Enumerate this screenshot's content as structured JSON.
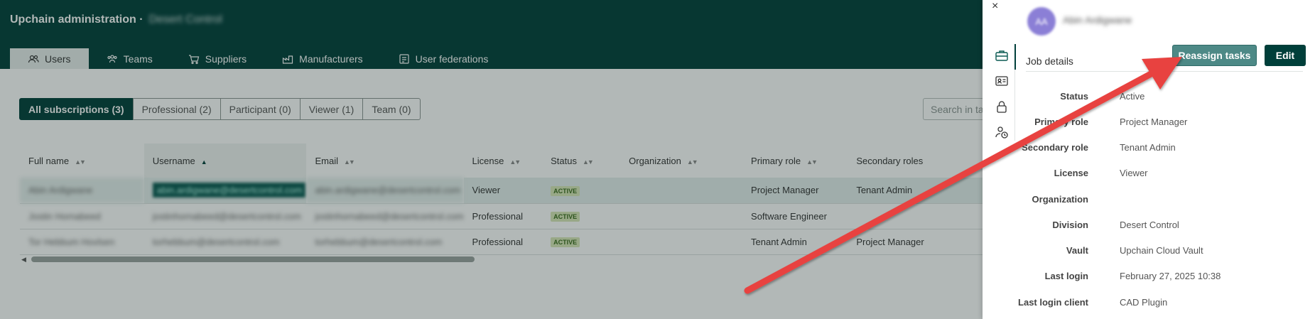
{
  "header": {
    "title": "Upchain administration ·",
    "org_name": "Desert Control"
  },
  "tabs": [
    {
      "label": "Users",
      "icon": "users-icon"
    },
    {
      "label": "Teams",
      "icon": "teams-icon"
    },
    {
      "label": "Suppliers",
      "icon": "suppliers-icon"
    },
    {
      "label": "Manufacturers",
      "icon": "manufacturers-icon"
    },
    {
      "label": "User federations",
      "icon": "federation-icon"
    }
  ],
  "filters": [
    "All subscriptions (3)",
    "Professional (2)",
    "Participant (0)",
    "Viewer (1)",
    "Team (0)"
  ],
  "search": {
    "placeholder": "Search in table"
  },
  "table": {
    "columns": [
      "Full name",
      "Username",
      "Email",
      "License",
      "Status",
      "Organization",
      "Primary role",
      "Secondary roles"
    ],
    "rows": [
      {
        "full_name": "Abin Ardigwane",
        "username": "abin.ardigwane@desertcontrol.com",
        "email": "abin.ardigwane@desertcontrol.com",
        "license": "Viewer",
        "status": "ACTIVE",
        "organization": "",
        "primary_role": "Project Manager",
        "secondary_roles": "Tenant Admin"
      },
      {
        "full_name": "Jostin Hornabeed",
        "username": "jostinhornabeed@desertcontrol.com",
        "email": "jostinhornabeed@desertcontrol.com",
        "license": "Professional",
        "status": "ACTIVE",
        "organization": "",
        "primary_role": "Software Engineer",
        "secondary_roles": ""
      },
      {
        "full_name": "Tor Hebbum Hovlsen",
        "username": "torhebbum@desertcontrol.com",
        "email": "torhebbum@desertcontrol.com",
        "license": "Professional",
        "status": "ACTIVE",
        "organization": "",
        "primary_role": "Tenant Admin",
        "secondary_roles": "Project Manager"
      }
    ]
  },
  "panel": {
    "close_glyph": "×",
    "avatar_initials": "AA",
    "user_name": "Abin Ardigwane",
    "section_title": "Job details",
    "reassign_label": "Reassign tasks",
    "edit_label": "Edit",
    "details": [
      {
        "label": "Status",
        "value": "Active"
      },
      {
        "label": "Primary role",
        "value": "Project Manager"
      },
      {
        "label": "Secondary role",
        "value": "Tenant Admin"
      },
      {
        "label": "License",
        "value": "Viewer"
      },
      {
        "label": "Organization",
        "value": ""
      },
      {
        "label": "Division",
        "value": "Desert Control"
      },
      {
        "label": "Vault",
        "value": "Upchain Cloud Vault"
      },
      {
        "label": "Last login",
        "value": "February 27, 2025 10:38"
      },
      {
        "label": "Last login client",
        "value": "CAD Plugin"
      }
    ]
  },
  "colors": {
    "brand_dark": "#003f3a",
    "reassign_button": "#4d8986",
    "annotation_arrow": "#e8423f"
  }
}
